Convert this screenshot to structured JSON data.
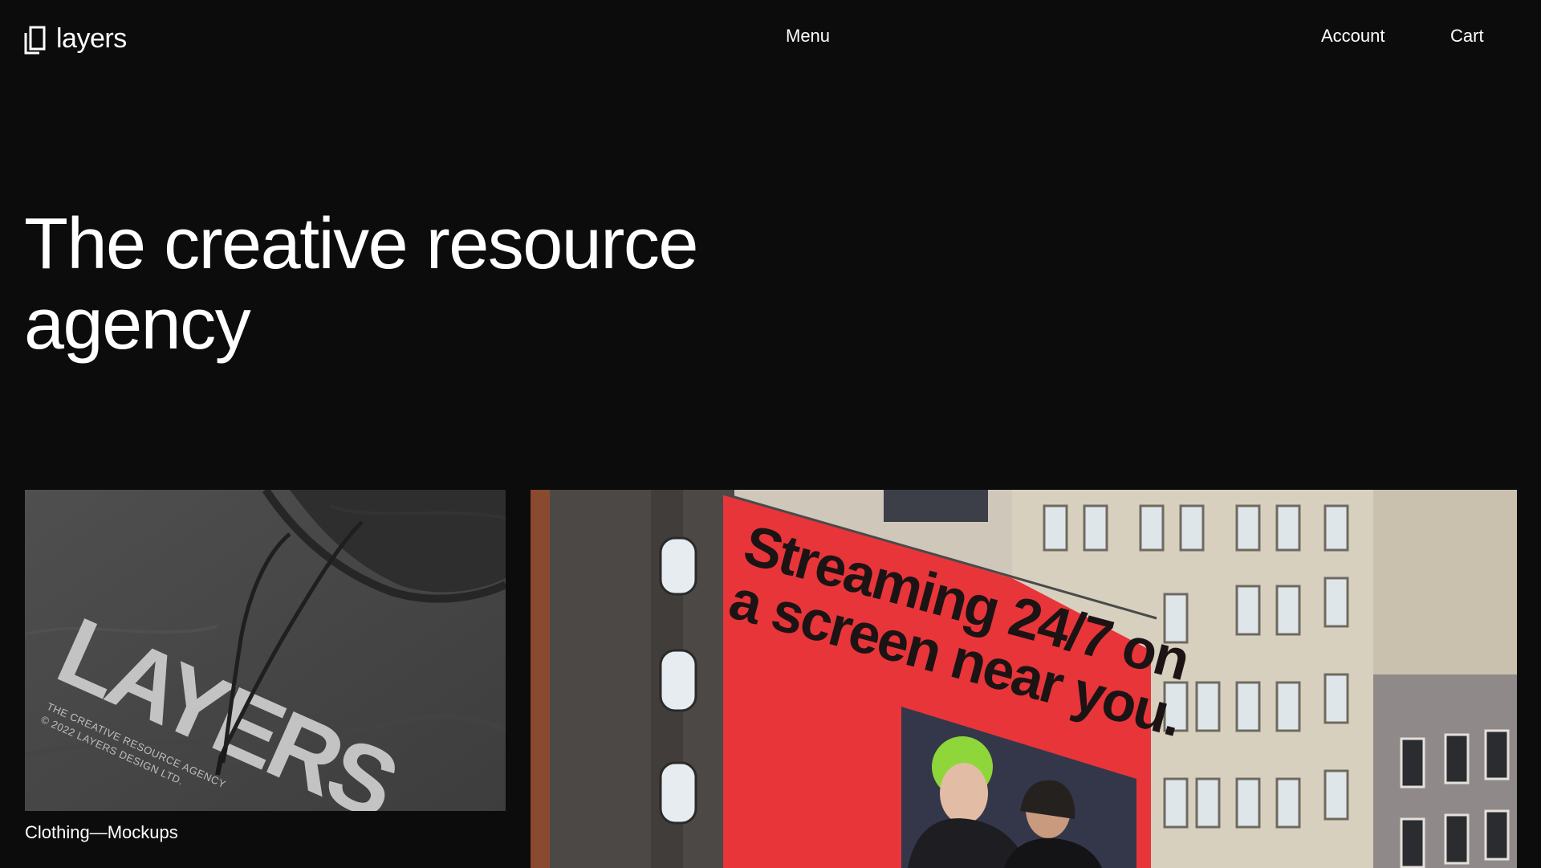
{
  "header": {
    "logo_text": "layers",
    "logo_icon": "layers-logo-icon",
    "nav": {
      "menu_label": "Menu",
      "account_label": "Account",
      "cart_label": "Cart"
    }
  },
  "hero": {
    "title_line1": "The creative resource",
    "title_line2": "agency"
  },
  "cards": {
    "left": {
      "caption": "Clothing—Mockups",
      "print_text": "LAYERS",
      "print_small_line1": "THE CREATIVE RESOURCE AGENCY",
      "print_small_line2": "© 2022 LAYERS DESIGN LTD."
    },
    "right": {
      "billboard_line1": "Streaming 24/7 on",
      "billboard_line2": "a screen near you."
    }
  },
  "colors": {
    "background": "#0b0c0b",
    "text": "#ffffff",
    "billboard_red": "#e8353a"
  }
}
